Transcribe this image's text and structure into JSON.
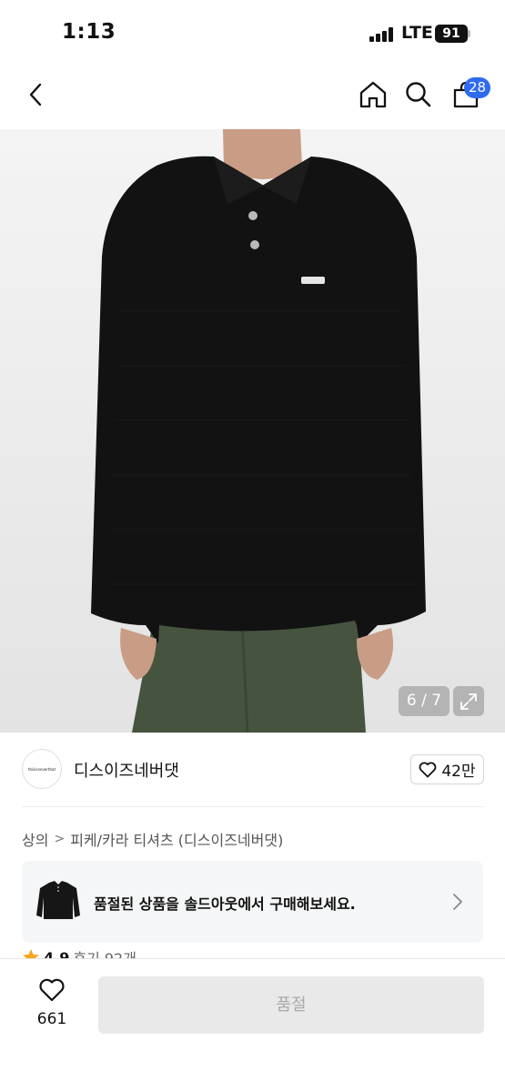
{
  "status_bar": {
    "time": "1:13",
    "network": "LTE",
    "battery": "91"
  },
  "nav": {
    "cart_count": "28"
  },
  "gallery": {
    "counter": "6 / 7"
  },
  "brand": {
    "name": "디스이즈네버댓",
    "logo_text": "thisisneverthat",
    "likes": "42만"
  },
  "breadcrumb": {
    "items": [
      "상의",
      "피케/카라 티셔츠 (디스이즈네버댓)"
    ]
  },
  "soldout_banner": {
    "text": "품절된 상품을 솔드아웃에서 구매해보세요."
  },
  "rating": {
    "score": "4.9",
    "reviews": "후기 92개"
  },
  "bottom": {
    "wish_count": "661",
    "buy_label": "품절"
  },
  "colors": {
    "accent": "#2f6bf0",
    "star": "#f5a623",
    "disabled_bg": "#e9e9e9",
    "disabled_text": "#a9a9a9"
  }
}
